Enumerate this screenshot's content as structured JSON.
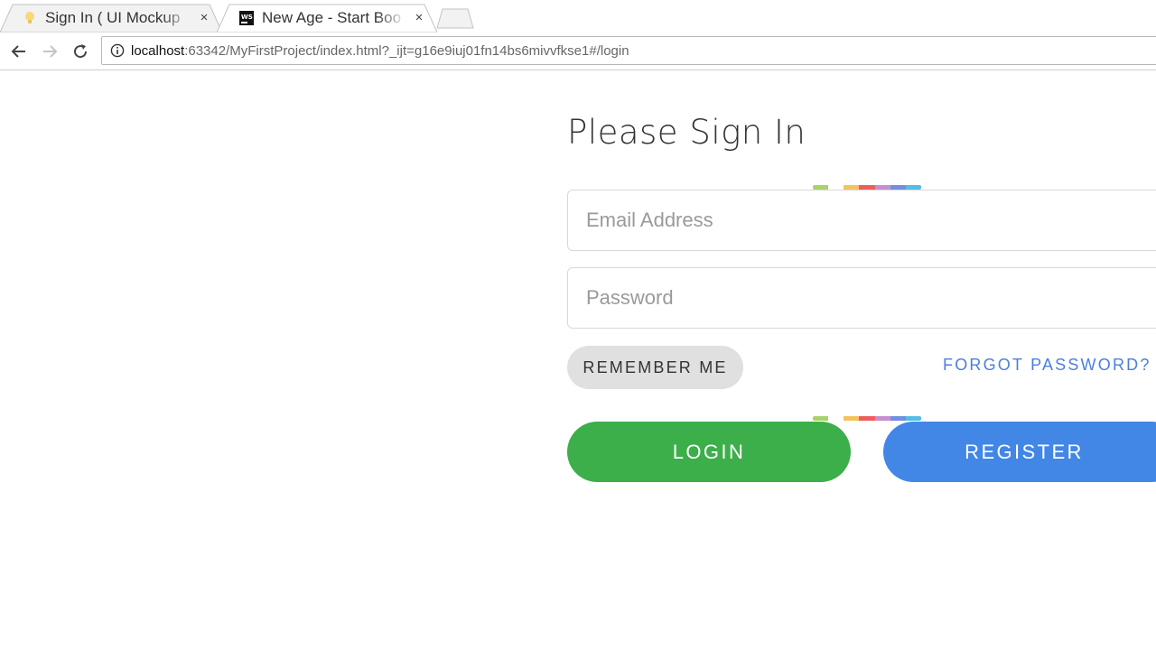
{
  "browser": {
    "tabs": [
      {
        "title": "Sign In ( UI Mockup",
        "close": "×",
        "favicon": "lightbulb-icon",
        "active": false
      },
      {
        "title": "New Age - Start Boo",
        "close": "×",
        "favicon": "webstorm-icon",
        "active": true
      }
    ],
    "url": {
      "host": "localhost",
      "rest": ":63342/MyFirstProject/index.html?_ijt=g16e9iuj01fn14bs6mivvfkse1#/login"
    }
  },
  "form": {
    "title": "Please Sign In",
    "email_placeholder": "Email Address",
    "password_placeholder": "Password",
    "remember_label": "REMEMBER ME",
    "forgot_label": "FORGOT PASSWORD?",
    "login_label": "LOGIN",
    "register_label": "REGISTER"
  },
  "colors": {
    "login": "#3cae4a",
    "register": "#4286e6",
    "forgot_link": "#4a7fe0",
    "remember_bg": "#e0e0e0",
    "rainbow": [
      "#a8d26a",
      "#ffffff",
      "#f5c35c",
      "#ee5d5d",
      "#c58fd0",
      "#6f8fe0",
      "#55bde3"
    ]
  }
}
